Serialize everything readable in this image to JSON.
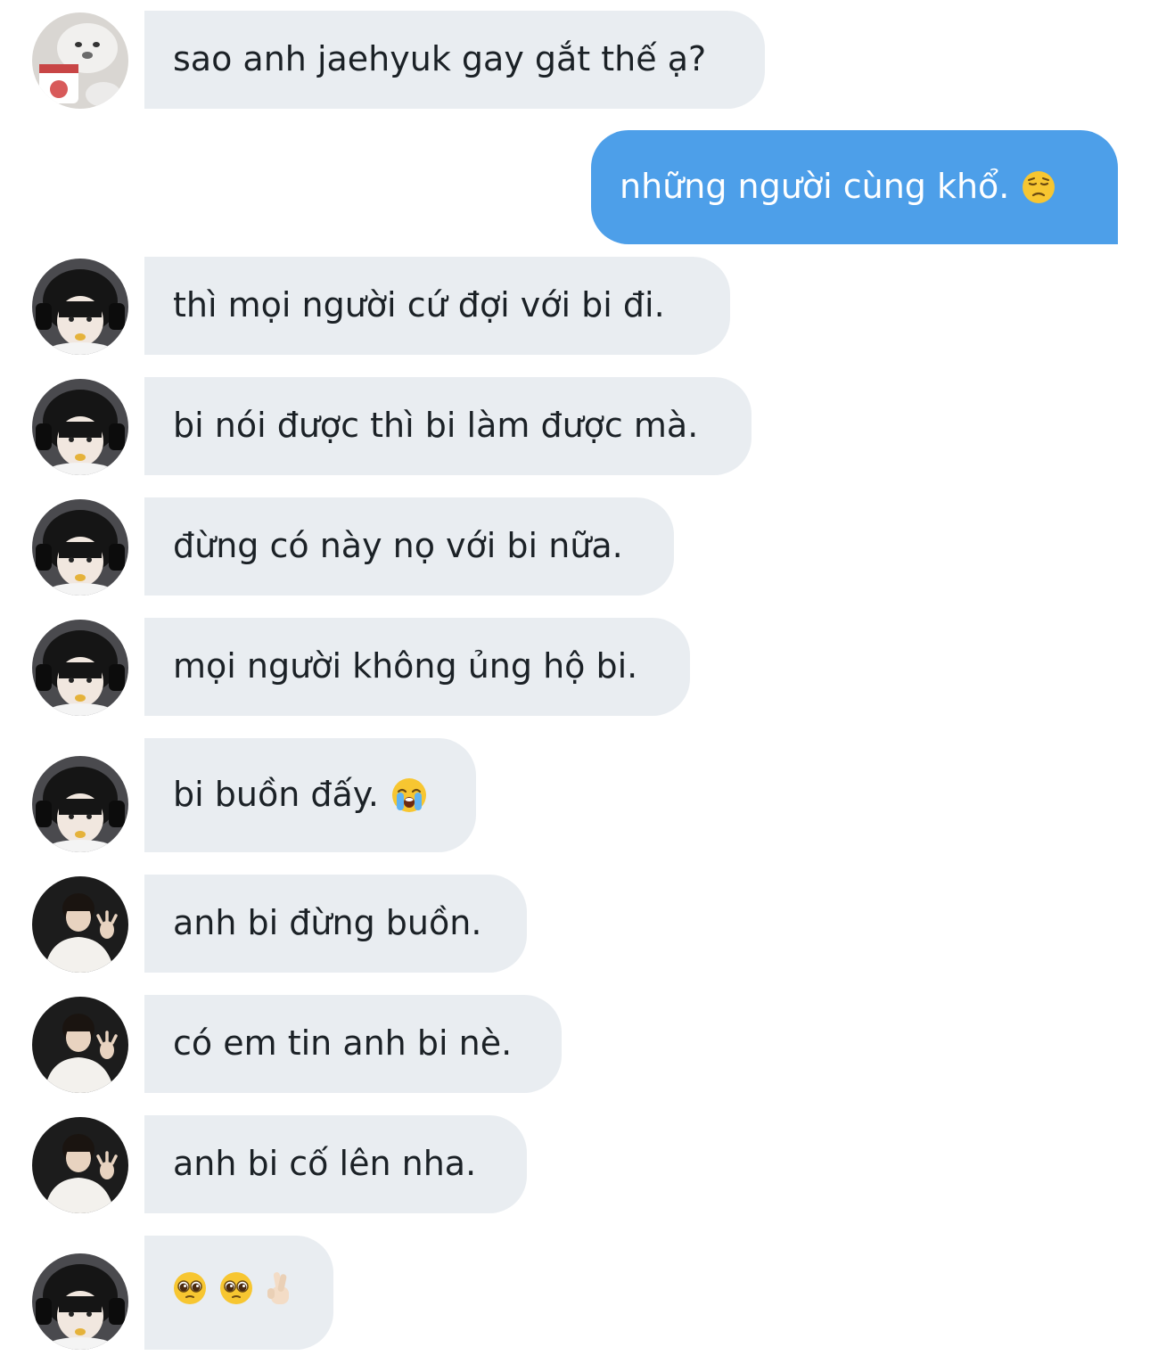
{
  "thread": {
    "messages": [
      {
        "sender": "bear",
        "text": "sao anh jaehyuk gay gắt thế ạ?"
      },
      {
        "sender": "me",
        "text": "những người cùng khổ.",
        "emoji": "pensive-face"
      },
      {
        "sender": "boy-headphones",
        "text": "thì mọi người cứ đợi với bi đi."
      },
      {
        "sender": "boy-headphones",
        "text": "bi nói được thì bi làm được mà."
      },
      {
        "sender": "boy-headphones",
        "text": "đừng có này nọ với bi nữa."
      },
      {
        "sender": "boy-headphones",
        "text": "mọi người không ủng hộ bi."
      },
      {
        "sender": "boy-headphones",
        "text": "bi buồn đấy.",
        "emoji": "loudly-crying-face"
      },
      {
        "sender": "man-white-shirt",
        "text": "anh bi đừng buồn."
      },
      {
        "sender": "man-white-shirt",
        "text": "có em tin anh bi nè."
      },
      {
        "sender": "man-white-shirt",
        "text": "anh bi cố lên nha."
      },
      {
        "sender": "boy-headphones",
        "text": "",
        "emojis": [
          "pleading-face",
          "pleading-face",
          "crossed-fingers"
        ]
      }
    ]
  },
  "colors": {
    "incoming_bubble": "#e9edf1",
    "outgoing_bubble": "#4d9fe9",
    "incoming_text": "#1b2126",
    "outgoing_text": "#ffffff"
  }
}
